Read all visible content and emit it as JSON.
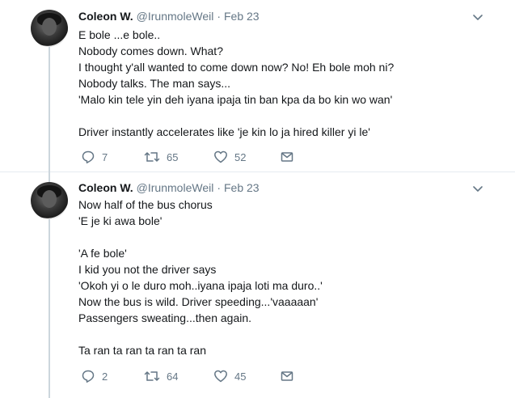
{
  "tweets": [
    {
      "author": {
        "name": "Coleon W.",
        "handle": "@IrunmoleWeil",
        "date": "Feb 23"
      },
      "text": "E bole ...e bole..\nNobody comes down. What?\nI thought y'all wanted to come down now? No! Eh bole moh ni?\nNobody talks. The man says...\n'Malo kin tele yin deh iyana ipaja tin ban kpa da bo kin wo wan'\n\nDriver instantly accelerates like 'je kin lo ja hired killer yi le'",
      "stats": {
        "replies": "7",
        "retweets": "65",
        "likes": "52"
      }
    },
    {
      "author": {
        "name": "Coleon W.",
        "handle": "@IrunmoleWeil",
        "date": "Feb 23"
      },
      "text": "Now half of the bus chorus\n'E je ki awa bole'\n\n'A fe bole'\nI kid you not the driver says\n'Okoh yi o le duro moh..iyana ipaja loti ma duro..'\nNow the bus is wild. Driver speeding...'vaaaaan'\nPassengers sweating...then again.\n\nTa ran ta ran ta ran ta ran",
      "stats": {
        "replies": "2",
        "retweets": "64",
        "likes": "45"
      }
    }
  ],
  "separator": "·",
  "icons": {
    "reply": "reply-icon",
    "retweet": "retweet-icon",
    "like": "heart-icon",
    "dm": "envelope-icon",
    "menu": "chevron-down-icon"
  },
  "colors": {
    "text": "#14171a",
    "secondary": "#657786",
    "thread_line": "#ccd6dd",
    "divider": "#e6ecf0"
  }
}
